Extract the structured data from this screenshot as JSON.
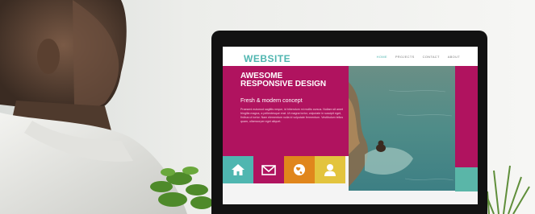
{
  "site": {
    "logo": "WEBSITE",
    "nav": [
      "HOME",
      "PROJECTS",
      "CONTACT",
      "ABOUT"
    ],
    "hero_title": "AWESOME RESPONSIVE DESIGN",
    "hero_subtitle": "Fresh & modern concept",
    "hero_body": "Praesent euismod sagittis neque, id bibendum mi mollis cursus. Nullam sit amet fringilla magna, a pellentesque erat. Ut magna tortor, vulputate in suscipit eget, finibus ut tortor. Nam elementum nulla id vulputate fermentum. Vestibulum tellus quam, ullamcorper eget aliquet."
  },
  "icons": [
    "home-icon",
    "mail-icon",
    "globe-icon",
    "user-icon"
  ],
  "colors": {
    "teal": "#4fb6b0",
    "magenta": "#b0135f",
    "orange": "#e0861c",
    "yellow": "#e3c43e"
  }
}
